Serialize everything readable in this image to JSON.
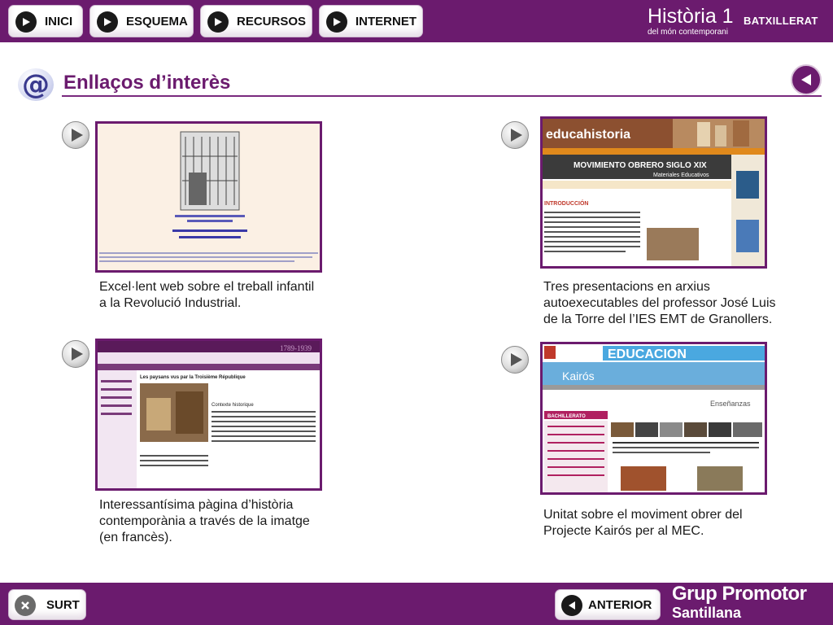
{
  "nav": {
    "items": [
      {
        "label": "INICI"
      },
      {
        "label": "ESQUEMA"
      },
      {
        "label": "RECURSOS"
      },
      {
        "label": "INTERNET"
      }
    ]
  },
  "brand": {
    "title": "Història 1",
    "level": "BATXILLERAT",
    "subtitle": "del món contemporani"
  },
  "page": {
    "title": "Enllaços d’interès"
  },
  "links": [
    {
      "lines": [
        "Excel·lent web sobre el treball infantil",
        "a la Revolució Industrial."
      ]
    },
    {
      "lines": [
        "Tres presentacions en arxius",
        "autoexecutables del professor José Luis",
        "de la Torre del l’IES EMT de Granollers."
      ]
    },
    {
      "lines": [
        "Interessantísima pàgina d’història",
        "contemporània a través de la imatge",
        "(en francès)."
      ]
    },
    {
      "lines": [
        "Unitat sobre el moviment obrer del",
        "Projecte  Kairós per al MEC."
      ]
    }
  ],
  "thumbs": {
    "educa": {
      "logo": "educahistoria",
      "banner": "MOVIMIENTO OBRERO SIGLO XIX",
      "sub": "Materiales Educativos",
      "section": "INTRODUCCIÓN"
    },
    "france": {
      "years": "1789-1939",
      "heading": "Les paysans vus par la Troisième République",
      "section": "Contexte historique"
    },
    "mec": {
      "banner": "EDUCACION",
      "kairos": "Kairós",
      "ense": "Enseñanzas",
      "bach": "BACHILLERATO"
    }
  },
  "footer": {
    "exit_label": "SURT",
    "prev_label": "ANTERIOR",
    "publisher_line1": "Grup Promotor",
    "publisher_line2": "Santillana"
  },
  "colors": {
    "accent": "#6b1b6e",
    "bar": "#6b1b6e"
  }
}
